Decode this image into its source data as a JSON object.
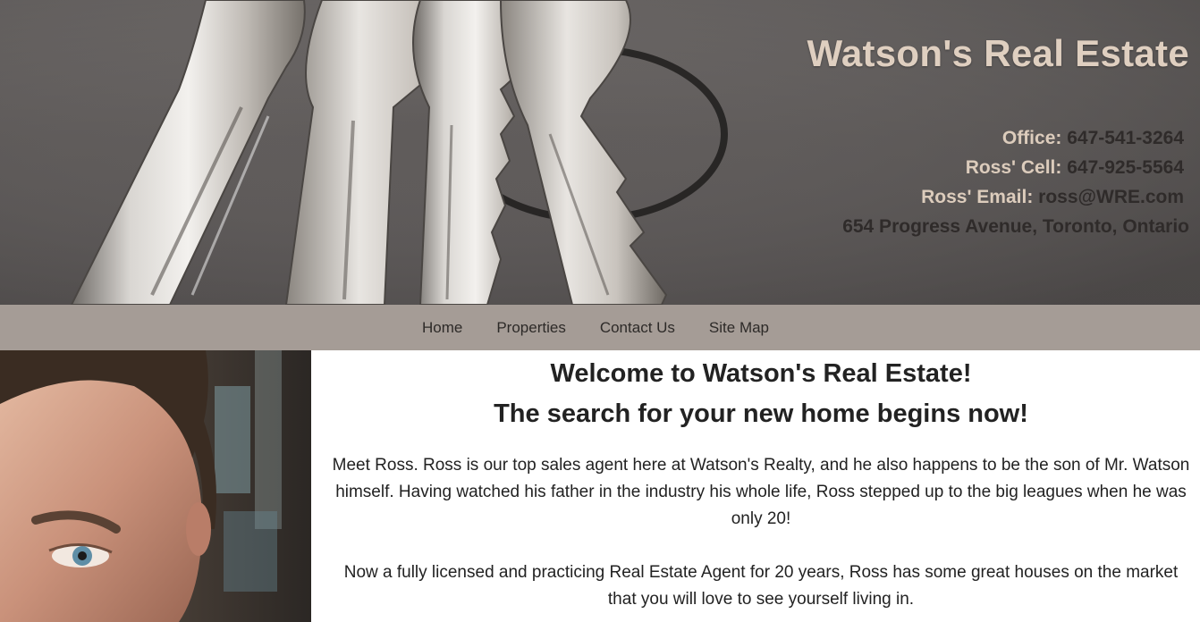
{
  "header": {
    "title": "Watson's Real Estate",
    "office_label": "Office:",
    "office_value": "647-541-3264",
    "cell_label": "Ross' Cell:",
    "cell_value": "647-925-5564",
    "email_label": "Ross' Email:",
    "email_value": "ross@WRE.com",
    "address": "654 Progress Avenue, Toronto, Ontario"
  },
  "nav": {
    "items": [
      "Home",
      "Properties",
      "Contact Us",
      "Site Map"
    ]
  },
  "main": {
    "heading1": "Welcome to Watson's Real Estate!",
    "heading2": "The search for your new home begins now!",
    "paragraph1": "Meet Ross. Ross is our top sales agent here at Watson's Realty, and he also happens to be the son of Mr. Watson himself. Having watched his father in the industry his whole life, Ross stepped up to the big leagues when he was only 20!",
    "paragraph2": "Now a fully licensed and practicing Real Estate Agent for 20 years, Ross has some great houses on the market that you will love to see yourself living in."
  },
  "colors": {
    "header_bg": "#5f5b5a",
    "title_color": "#dfcfc0",
    "nav_bg": "#a59c96",
    "text_dark": "#222222"
  },
  "images": {
    "header": "house-keys-photo",
    "portrait": "agent-portrait-photo"
  }
}
